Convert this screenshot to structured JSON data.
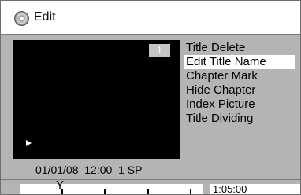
{
  "header": {
    "icon": "disc-icon",
    "title": "Edit"
  },
  "video": {
    "title_number": "1",
    "status_icon": "play-icon"
  },
  "menu": {
    "items": [
      {
        "label": "Title Delete",
        "selected": false
      },
      {
        "label": "Edit Title Name",
        "selected": true
      },
      {
        "label": "Chapter Mark",
        "selected": false
      },
      {
        "label": "Hide Chapter",
        "selected": false
      },
      {
        "label": "Index Picture",
        "selected": false
      },
      {
        "label": "Title Dividing",
        "selected": false
      }
    ]
  },
  "info": {
    "recording": "01/01/08  12:00  1 SP"
  },
  "timeline": {
    "marker": "Y",
    "duration": "1:05:00"
  },
  "colors": {
    "panel": "#b4b4b4",
    "screen": "#000000",
    "highlight": "#ffffff"
  }
}
